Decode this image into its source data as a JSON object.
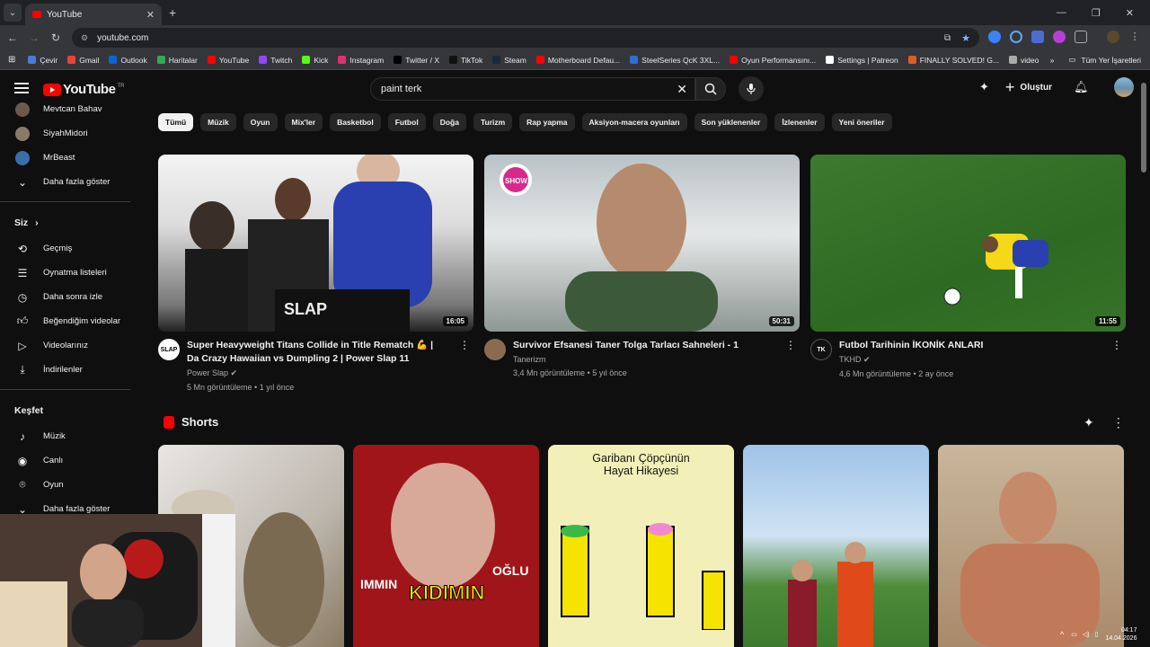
{
  "browser": {
    "tab_title": "YouTube",
    "url": "youtube.com",
    "bookmarks": [
      {
        "label": "Çevir",
        "color": "#4a7bd6"
      },
      {
        "label": "Gmail",
        "color": "#ea4335"
      },
      {
        "label": "Outlook",
        "color": "#0a64d6"
      },
      {
        "label": "Haritalar",
        "color": "#34a853"
      },
      {
        "label": "YouTube",
        "color": "#ff0000"
      },
      {
        "label": "Twitch",
        "color": "#9146ff"
      },
      {
        "label": "Kick",
        "color": "#53fc18"
      },
      {
        "label": "Instagram",
        "color": "#e1306c"
      },
      {
        "label": "Twitter / X",
        "color": "#000000"
      },
      {
        "label": "TikTok",
        "color": "#111111"
      },
      {
        "label": "Steam",
        "color": "#1b2838"
      },
      {
        "label": "Motherboard Defau...",
        "color": "#ff0000"
      },
      {
        "label": "SteelSeries QcK 3XL...",
        "color": "#2a6fd6"
      },
      {
        "label": "Oyun Performansını...",
        "color": "#ff0000"
      },
      {
        "label": "Settings | Patreon",
        "color": "#ffffff"
      },
      {
        "label": "FINALLY SOLVED! G...",
        "color": "#e05a2a"
      },
      {
        "label": "video",
        "color": "#aaaaaa"
      }
    ],
    "bookmarks_more": "»",
    "all_bookmarks": "Tüm Yer İşaretleri"
  },
  "header": {
    "logo_text": "YouTube",
    "logo_sup": "TR",
    "search_value": "paint terk",
    "create_label": "Oluştur"
  },
  "sidebar": {
    "subscriptions": [
      {
        "name": "Mevtcan Bahav",
        "color": "#6b5a4a"
      },
      {
        "name": "SiyahMidori",
        "color": "#8a7a6a"
      },
      {
        "name": "MrBeast",
        "color": "#3a6ea8"
      }
    ],
    "show_more": "Daha fazla göster",
    "you_title": "Siz",
    "you_items": [
      {
        "label": "Geçmiş",
        "icon": "history-icon"
      },
      {
        "label": "Oynatma listeleri",
        "icon": "playlists-icon"
      },
      {
        "label": "Daha sonra izle",
        "icon": "watch-later-icon"
      },
      {
        "label": "Beğendiğim videolar",
        "icon": "like-icon"
      },
      {
        "label": "Videolarınız",
        "icon": "your-videos-icon"
      },
      {
        "label": "İndirilenler",
        "icon": "download-icon"
      }
    ],
    "explore_title": "Keşfet",
    "explore_items": [
      {
        "label": "Müzik",
        "icon": "music-icon"
      },
      {
        "label": "Canlı",
        "icon": "live-icon"
      },
      {
        "label": "Oyun",
        "icon": "gaming-icon"
      }
    ],
    "show_more_2": "Daha fazla göster"
  },
  "chips": [
    "Tümü",
    "Müzik",
    "Oyun",
    "Mix'ler",
    "Basketbol",
    "Futbol",
    "Doğa",
    "Turizm",
    "Rap yapma",
    "Aksiyon-macera oyunları",
    "Son yüklenenler",
    "İzlenenler",
    "Yeni öneriler"
  ],
  "videos": [
    {
      "title": "Super Heavyweight Titans Collide in Title Rematch 💪 | Da Crazy Hawaiian vs Dumpling 2 | Power Slap 11",
      "channel": "Power Slap",
      "verified": "✔",
      "stats": "5 Mn görüntüleme • 1 yıl önce",
      "duration": "16:05",
      "avatar_text": "SLAP"
    },
    {
      "title": "Survivor Efsanesi Taner Tolga Tarlacı Sahneleri - 1",
      "channel": "Tanerizm",
      "verified": "",
      "stats": "3,4 Mn görüntüleme • 5 yıl önce",
      "duration": "50:31",
      "avatar_text": ""
    },
    {
      "title": "Futbol Tarihinin İKONİK ANLARI",
      "channel": "TKHD",
      "verified": "✔",
      "stats": "4,6 Mn görüntüleme • 2 ay önce",
      "duration": "11:55",
      "avatar_text": "TK"
    }
  ],
  "shorts": {
    "title": "Shorts",
    "items": [
      {
        "text": ""
      },
      {
        "text": "KIDIMIN"
      },
      {
        "text": "Garibanı Çöpçünün Hayat Hikayesi"
      },
      {
        "text": ""
      },
      {
        "text": ""
      }
    ]
  },
  "thumb_texts": {
    "show_logo": "SHOW",
    "short2_top": "OĞLU",
    "short2_mid": "IMMIN"
  },
  "system": {
    "time": "04:17",
    "date": "14.04.2026"
  }
}
